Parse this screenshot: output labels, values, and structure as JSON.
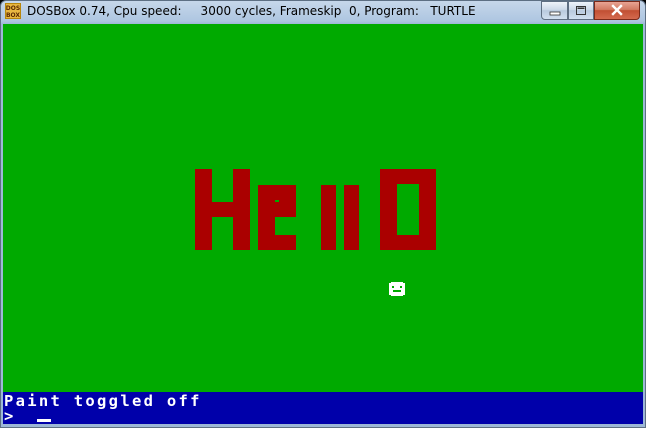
{
  "window": {
    "title": "DOSBox 0.74, Cpu speed:     3000 cycles, Frameskip  0, Program:   TURTLE",
    "icon": "dosbox-icon",
    "buttons": [
      "minimize-icon",
      "maximize-icon",
      "close-icon"
    ]
  },
  "screen": {
    "background_color": "#00aa00",
    "drawing_color": "#aa0000",
    "turtle_color": "#ffffff",
    "drawing_text": "HeIIO",
    "status_bar_color": "#0000aa",
    "status_message": "Paint toggled off",
    "prompt": ">"
  }
}
